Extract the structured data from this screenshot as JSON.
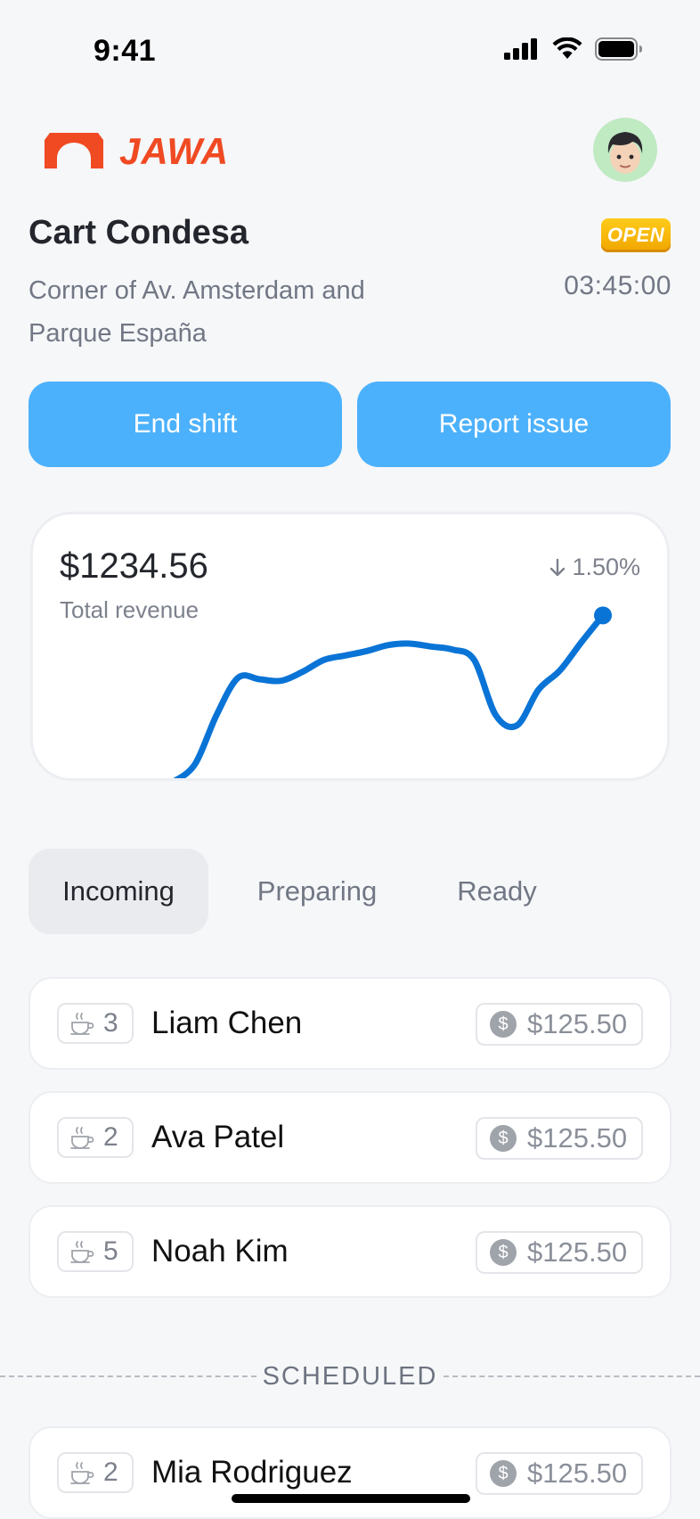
{
  "status_bar": {
    "time": "9:41",
    "signal_icon": "cellular-signal-icon",
    "wifi_icon": "wifi-icon",
    "battery_icon": "battery-icon"
  },
  "header": {
    "brand_name": "JAWA",
    "brand_color": "#f04a23",
    "logo_icon": "jawa-logo-icon",
    "avatar_icon": "user-avatar"
  },
  "cart": {
    "title": "Cart Condesa",
    "status_badge": "OPEN",
    "address": "Corner of Av. Amsterdam and Parque España",
    "timer": "03:45:00"
  },
  "actions": {
    "end_shift_label": "End shift",
    "report_issue_label": "Report issue",
    "button_color": "#4cb1fc"
  },
  "revenue": {
    "amount": "$1234.56",
    "label": "Total revenue",
    "change": "1.50%",
    "change_direction": "down",
    "line_color": "#0a74d6"
  },
  "chart_data": {
    "type": "line",
    "title": "",
    "xlabel": "",
    "ylabel": "",
    "grid": false,
    "x": [
      0,
      1,
      2,
      3,
      4,
      5,
      6,
      7,
      8,
      9,
      10,
      11,
      12,
      13,
      14,
      15,
      16,
      17,
      18,
      19,
      20
    ],
    "series": [
      {
        "values": [
          0,
          12,
          45,
          70,
          69,
          68,
          74,
          82,
          85,
          88,
          92,
          93,
          91,
          89,
          82,
          45,
          38,
          62,
          75,
          94,
          112
        ]
      }
    ],
    "ylim": [
      0,
      120
    ],
    "end_marker": true
  },
  "tabs": [
    {
      "label": "Incoming",
      "active": true
    },
    {
      "label": "Preparing",
      "active": false
    },
    {
      "label": "Ready",
      "active": false
    }
  ],
  "orders": [
    {
      "qty": "3",
      "name": "Liam Chen",
      "price": "$125.50"
    },
    {
      "qty": "2",
      "name": "Ava Patel",
      "price": "$125.50"
    },
    {
      "qty": "5",
      "name": "Noah Kim",
      "price": "$125.50"
    }
  ],
  "scheduled": {
    "label": "SCHEDULED",
    "orders": [
      {
        "qty": "2",
        "name": "Mia Rodriguez",
        "price": "$125.50"
      }
    ]
  },
  "icons": {
    "cup": "coffee-cup-icon",
    "coin": "dollar-coin-icon",
    "coin_symbol": "$",
    "arrow": "arrow-down-icon"
  }
}
